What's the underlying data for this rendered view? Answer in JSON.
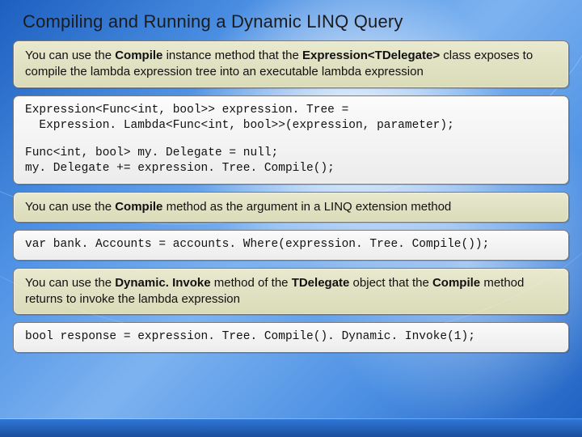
{
  "title": "Compiling and Running a Dynamic LINQ Query",
  "blocks": {
    "d1": {
      "pre1": "You can use the ",
      "b1": "Compile",
      "mid1": " instance method that the ",
      "b2": "Expression<TDelegate>",
      "post1": " class exposes to compile the lambda expression tree into an executable lambda expression"
    },
    "c1": {
      "l1": "Expression<Func<int, bool>> expression. Tree =",
      "l2": "  Expression. Lambda<Func<int, bool>>(expression, parameter);",
      "l3": "Func<int, bool> my. Delegate = null;",
      "l4": "my. Delegate += expression. Tree. Compile();"
    },
    "d2": {
      "pre1": "You can use the ",
      "b1": "Compile",
      "post1": " method as the argument in a LINQ extension method"
    },
    "c2": {
      "l1": "var bank. Accounts = accounts. Where(expression. Tree. Compile());"
    },
    "d3": {
      "pre1": "You can use the ",
      "b1": "Dynamic. Invoke",
      "mid1": " method of the ",
      "b2": "TDelegate",
      "mid2": " object that the ",
      "b3": "Compile",
      "post1": " method returns to invoke the lambda expression"
    },
    "c3": {
      "l1": "bool response = expression. Tree. Compile(). Dynamic. Invoke(1);"
    }
  }
}
